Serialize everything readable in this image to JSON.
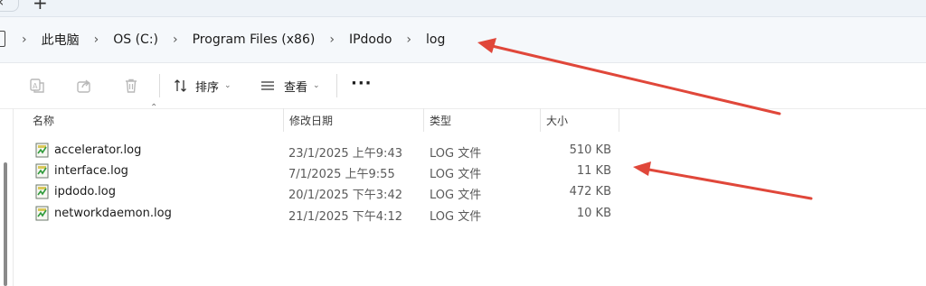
{
  "breadcrumb": [
    "此电脑",
    "OS (C:)",
    "Program Files (x86)",
    "IPdodo",
    "log"
  ],
  "toolbar": {
    "sort_label": "排序",
    "view_label": "查看",
    "more_label": "···"
  },
  "columns": {
    "name": "名称",
    "date": "修改日期",
    "type": "类型",
    "size": "大小"
  },
  "files": [
    {
      "name": "accelerator.log",
      "date": "23/1/2025 上午9:43",
      "type": "LOG 文件",
      "size": "510 KB"
    },
    {
      "name": "interface.log",
      "date": "7/1/2025 上午9:55",
      "type": "LOG 文件",
      "size": "11 KB"
    },
    {
      "name": "ipdodo.log",
      "date": "20/1/2025 下午3:42",
      "type": "LOG 文件",
      "size": "472 KB"
    },
    {
      "name": "networkdaemon.log",
      "date": "21/1/2025 下午4:12",
      "type": "LOG 文件",
      "size": "10 KB"
    }
  ],
  "colors": {
    "arrow": "#e0473a",
    "address_bg": "#f5f8fb",
    "tabstrip_bg": "#eef3f8"
  },
  "icons": {
    "new_tab": "plus-icon",
    "ai": "ai-icon",
    "share": "share-icon",
    "delete": "trash-icon",
    "sort": "sort-icon",
    "view": "view-icon",
    "file": "log-file-icon"
  }
}
